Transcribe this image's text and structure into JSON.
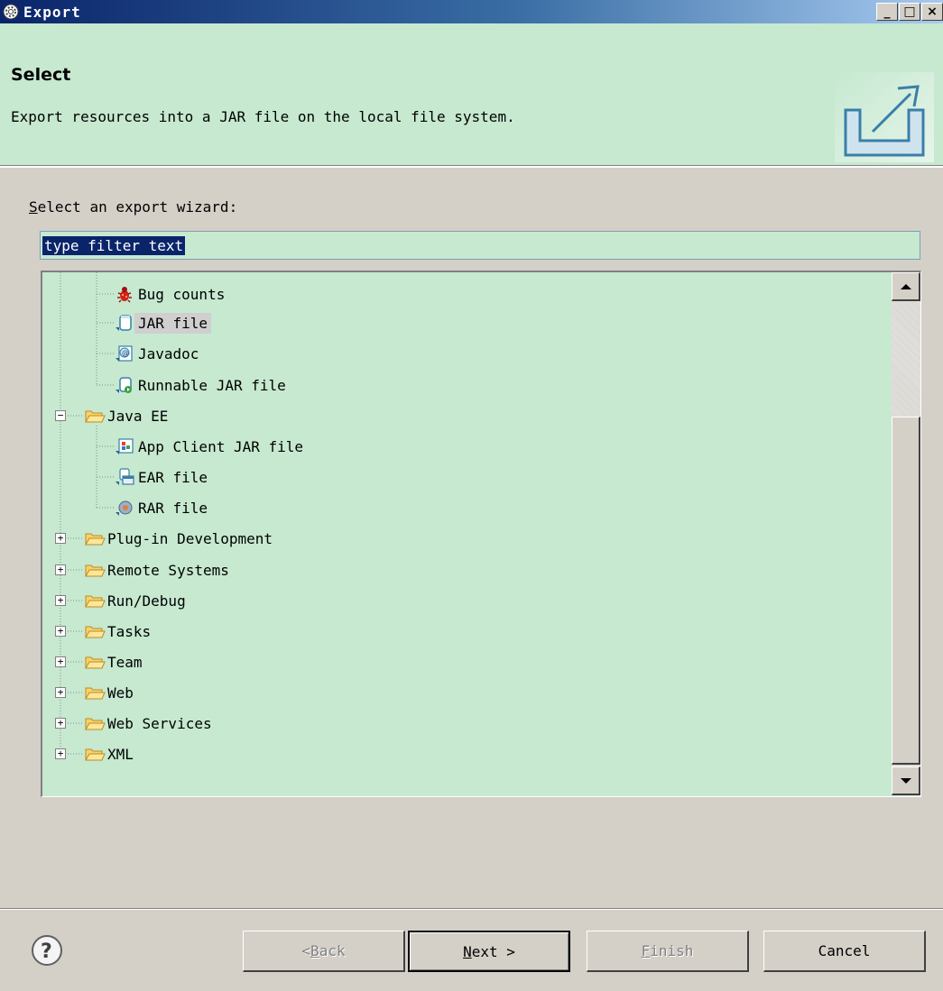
{
  "window": {
    "title": "Export",
    "minimize_glyph": "_",
    "maximize_glyph": "□",
    "close_glyph": "×"
  },
  "header": {
    "title": "Select",
    "description": "Export resources into a JAR file on the local file system."
  },
  "wizard": {
    "select_label_mnemonic": "S",
    "select_label_rest": "elect an export wizard:",
    "filter_text": "type filter text"
  },
  "tree": {
    "items": [
      {
        "label": "Bug counts",
        "icon": "bug-icon",
        "level": 2
      },
      {
        "label": "JAR file",
        "icon": "jar-icon",
        "level": 2,
        "selected": true
      },
      {
        "label": "Javadoc",
        "icon": "javadoc-icon",
        "level": 2
      },
      {
        "label": "Runnable JAR file",
        "icon": "runnable-jar-icon",
        "level": 2
      },
      {
        "label": "Java EE",
        "icon": "folder-icon",
        "level": 1,
        "expanded": true
      },
      {
        "label": "App Client JAR file",
        "icon": "app-client-icon",
        "level": 2
      },
      {
        "label": "EAR file",
        "icon": "ear-icon",
        "level": 2
      },
      {
        "label": "RAR file",
        "icon": "rar-icon",
        "level": 2
      },
      {
        "label": "Plug-in Development",
        "icon": "folder-icon",
        "level": 1,
        "expanded": false
      },
      {
        "label": "Remote Systems",
        "icon": "folder-icon",
        "level": 1,
        "expanded": false
      },
      {
        "label": "Run/Debug",
        "icon": "folder-icon",
        "level": 1,
        "expanded": false
      },
      {
        "label": "Tasks",
        "icon": "folder-icon",
        "level": 1,
        "expanded": false
      },
      {
        "label": "Team",
        "icon": "folder-icon",
        "level": 1,
        "expanded": false
      },
      {
        "label": "Web",
        "icon": "folder-icon",
        "level": 1,
        "expanded": false
      },
      {
        "label": "Web Services",
        "icon": "folder-icon",
        "level": 1,
        "expanded": false
      },
      {
        "label": "XML",
        "icon": "folder-icon",
        "level": 1,
        "expanded": false
      }
    ]
  },
  "buttons": {
    "back_prefix": "< ",
    "back_mnemonic": "B",
    "back_rest": "ack",
    "next_mnemonic": "N",
    "next_rest": "ext >",
    "finish_mnemonic": "F",
    "finish_rest": "inish",
    "cancel": "Cancel"
  },
  "colors": {
    "background": "#d4d0c8",
    "panel_green": "#c6e9d0",
    "title_bar": "#0a246a",
    "selection": "#0a246a"
  }
}
